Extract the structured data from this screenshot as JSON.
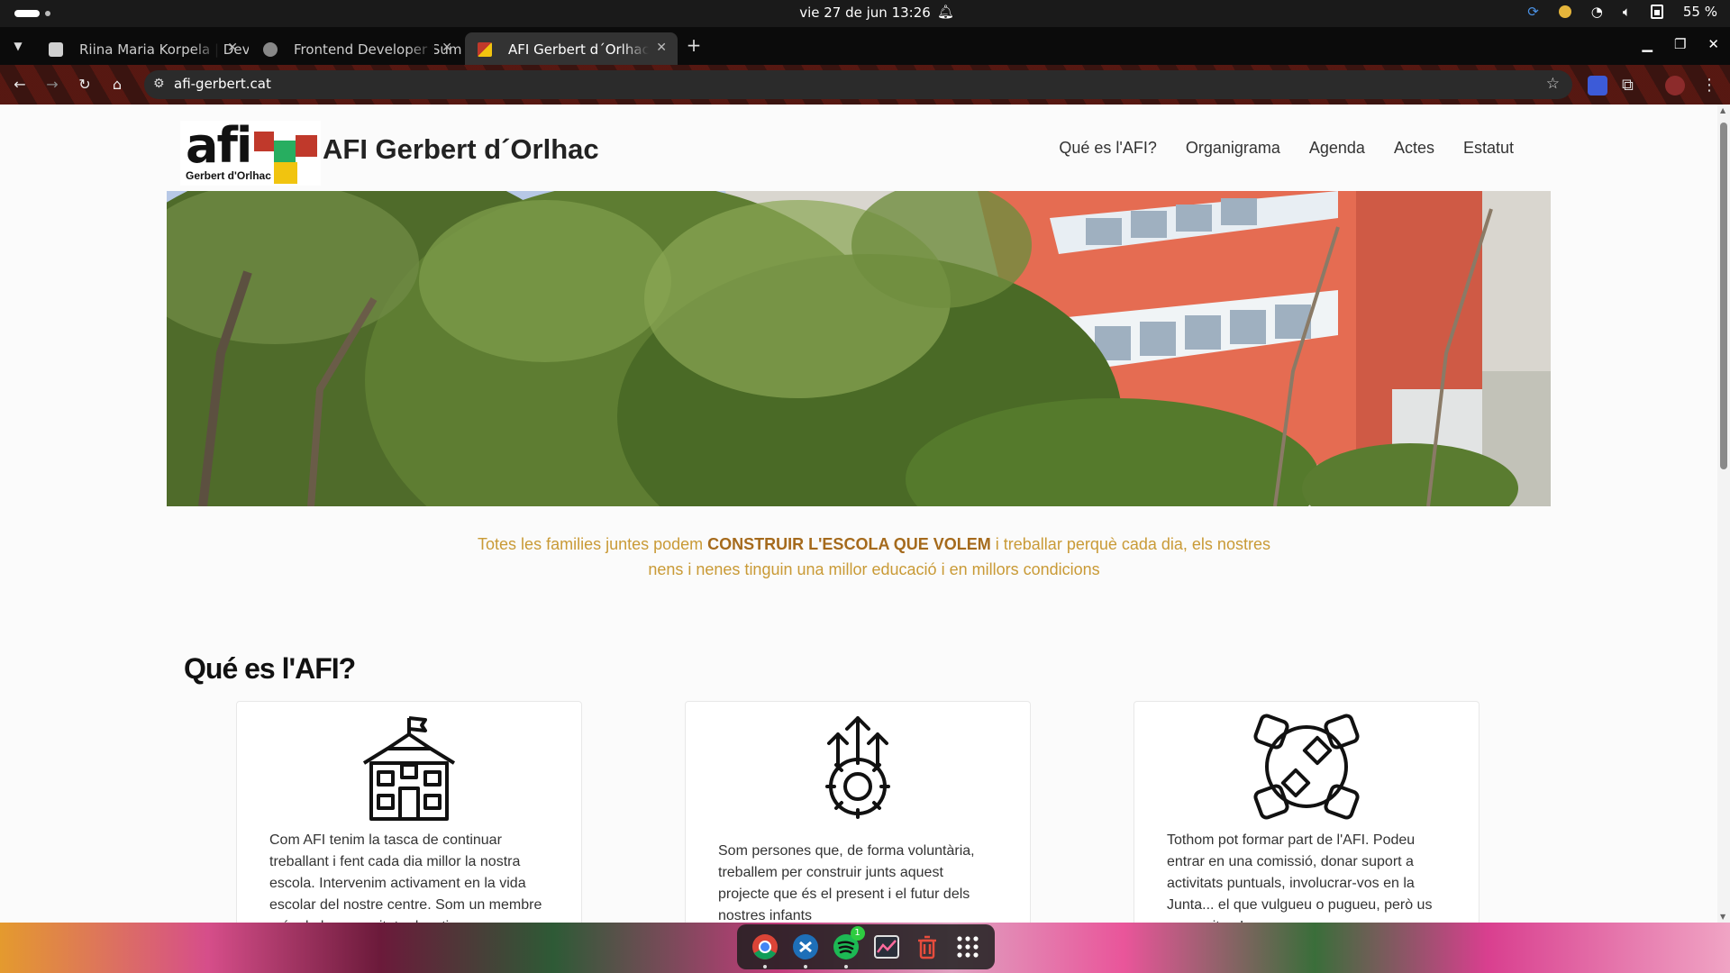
{
  "system": {
    "clock": "vie 27 de jun  13:26",
    "battery": "55 %"
  },
  "browser": {
    "tabs": [
      {
        "title": "Riina Maria Korpela | Dev",
        "active": false
      },
      {
        "title": "Frontend Developer Sum",
        "active": false
      },
      {
        "title": "AFI Gerbert d´Orlhac",
        "active": true
      }
    ],
    "url": "afi-gerbert.cat"
  },
  "site": {
    "logo_text": "afi",
    "logo_sub": "Gerbert d'Orlhac",
    "title": "AFI Gerbert d´Orlhac",
    "nav": [
      "Qué es l'AFI?",
      "Organigrama",
      "Agenda",
      "Actes",
      "Estatut"
    ],
    "tagline": {
      "before": "Totes les families juntes podem ",
      "emphasis": "CONSTRUIR L'ESCOLA QUE VOLEM",
      "after": " i treballar perquè cada dia, els nostres nens i nenes tinguin una millor educació i en millors condicions"
    },
    "section_title": "Qué es l'AFI?",
    "cards": [
      {
        "icon": "school-icon",
        "text": "Com AFI tenim la tasca de continuar treballant i fent cada dia millor la nostra escola. Intervenim activament en la vida escolar del nostre centre. Som un membre més de la comunitat educativa"
      },
      {
        "icon": "growth-gear-icon",
        "text": "Som persones que, de forma voluntària, treballem per construir junts aquest projecte que és el present i el futur dels nostres infants"
      },
      {
        "icon": "hands-circle-icon",
        "text": "Tothom pot formar part de l'AFI. Podeu entrar en una comissió, donar suport a activitats puntuals, involucrar-vos en la Junta... el que vulgueu o pugueu, però us necessitem!"
      }
    ]
  },
  "dock": {
    "spotify_badge": "1"
  },
  "colors": {
    "tagline": "#c99a36",
    "tagline_strong": "#a56a1c",
    "logo_red": "#c0392b",
    "logo_green": "#27ae60",
    "logo_yellow": "#f1c40f"
  }
}
